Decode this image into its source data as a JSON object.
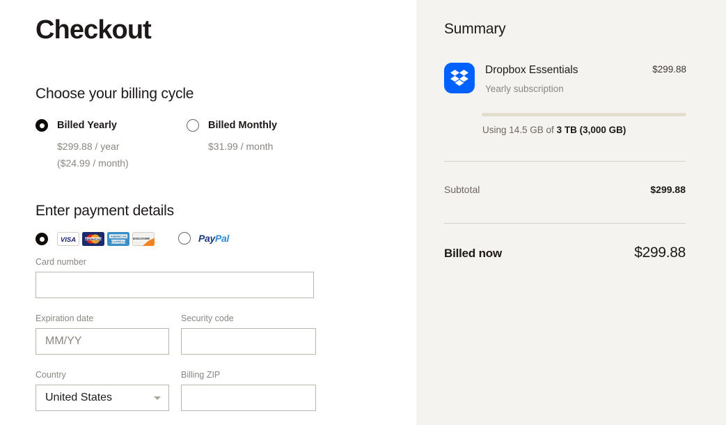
{
  "page": {
    "title": "Checkout"
  },
  "billing": {
    "heading": "Choose your billing cycle",
    "options": [
      {
        "label": "Billed Yearly",
        "price": "$299.88 / year",
        "note": "($24.99 / month)",
        "selected": true
      },
      {
        "label": "Billed Monthly",
        "price": "$31.99 / month",
        "note": "",
        "selected": false
      }
    ]
  },
  "payment": {
    "heading": "Enter payment details",
    "methods": [
      {
        "name": "credit-card",
        "selected": true
      },
      {
        "name": "paypal",
        "selected": false
      }
    ],
    "card_brands": [
      "visa",
      "mastercard",
      "american-express",
      "discover"
    ],
    "paypal_label_first": "Pay",
    "paypal_label_second": "Pal",
    "fields": {
      "card_number_label": "Card number",
      "card_number_value": "",
      "card_number_placeholder": "",
      "expiration_label": "Expiration date",
      "expiration_value": "",
      "expiration_placeholder": "MM/YY",
      "security_label": "Security code",
      "security_value": "",
      "security_placeholder": "",
      "country_label": "Country",
      "country_value": "United States",
      "zip_label": "Billing ZIP",
      "zip_value": "",
      "zip_placeholder": ""
    }
  },
  "summary": {
    "title": "Summary",
    "plan": {
      "name": "Dropbox Essentials",
      "subtitle": "Yearly subscription",
      "price": "$299.88",
      "logo_icon": "dropbox-logo-icon"
    },
    "usage": {
      "prefix": "Using 14.5 GB of ",
      "total": "3 TB (3,000 GB)",
      "used_gb": 14.5,
      "total_gb": 3000,
      "percent": 0.48
    },
    "subtotal_label": "Subtotal",
    "subtotal_value": "$299.88",
    "billed_now_label": "Billed now",
    "billed_now_value": "$299.88"
  },
  "colors": {
    "panel_bg": "#f4f3f0",
    "dropbox_blue": "#0061ff",
    "usage_track": "#e4dece",
    "border": "#b9b5ac",
    "muted_text": "#8b8681"
  }
}
